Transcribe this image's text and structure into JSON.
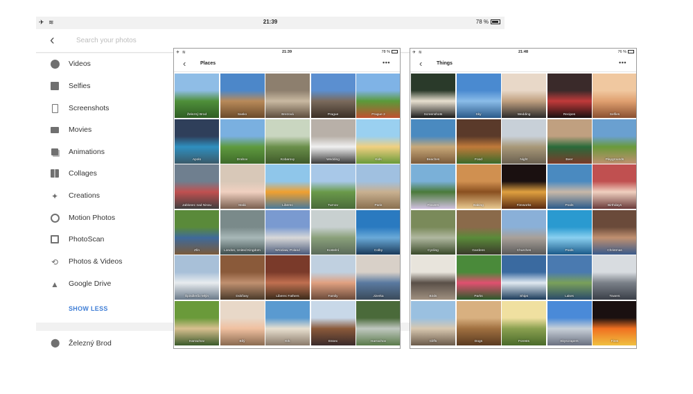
{
  "back_screen": {
    "status": {
      "time": "21:39",
      "battery": "78 %",
      "left_icons": "✈ ≋"
    },
    "search": {
      "placeholder": "Search your photos"
    },
    "categories": [
      {
        "label": "Videos",
        "icon": "play-circle-icon"
      },
      {
        "label": "Selfies",
        "icon": "person-square-icon"
      },
      {
        "label": "Screenshots",
        "icon": "phone-icon"
      },
      {
        "label": "Movies",
        "icon": "film-icon"
      },
      {
        "label": "Animations",
        "icon": "stack-icon"
      },
      {
        "label": "Collages",
        "icon": "grid-icon"
      },
      {
        "label": "Creations",
        "icon": "sparkle-icon"
      },
      {
        "label": "Motion Photos",
        "icon": "motion-icon"
      },
      {
        "label": "PhotoScan",
        "icon": "photoscan-icon"
      },
      {
        "label": "Photos & Videos",
        "icon": "sync-icon"
      },
      {
        "label": "Google Drive",
        "icon": "drive-icon"
      }
    ],
    "show_less": "SHOW LESS",
    "places_first": "Železný Brod"
  },
  "places_panel": {
    "status": {
      "time": "21:39",
      "battery": "78 %"
    },
    "title": "Places",
    "more": "•••",
    "tiles": [
      {
        "label": "Železný Brod",
        "colors": [
          "#8fbde6",
          "#4f8f3a",
          "#2f5e24"
        ]
      },
      {
        "label": "Sasko",
        "colors": [
          "#4c87c9",
          "#b88a5a",
          "#6b4a2a"
        ]
      },
      {
        "label": "Brezová",
        "colors": [
          "#8d7f6e",
          "#c9b9a1",
          "#5d4d3d"
        ]
      },
      {
        "label": "Prague",
        "colors": [
          "#5b8fd0",
          "#7a6a5c",
          "#3b2f25"
        ]
      },
      {
        "label": "Prague 2",
        "colors": [
          "#7fb3e6",
          "#5a9a3a",
          "#c05030"
        ]
      },
      {
        "label": "Apolo",
        "colors": [
          "#2f3f5a",
          "#2f8fbf",
          "#3a5a6a"
        ]
      },
      {
        "label": "Drahov",
        "colors": [
          "#7ab0e0",
          "#5e9a3e",
          "#3f6a2a"
        ]
      },
      {
        "label": "Kobarovy",
        "colors": [
          "#c9d6c0",
          "#6a8f4a",
          "#3f5a2a"
        ]
      },
      {
        "label": "Wedding",
        "colors": [
          "#b8b0a8",
          "#f0f0f0",
          "#3a3a3a"
        ]
      },
      {
        "label": "Kids",
        "colors": [
          "#9ad0f0",
          "#f0d080",
          "#6a9a3a"
        ]
      },
      {
        "label": "Jablonec nad Nisou",
        "colors": [
          "#6f7f8f",
          "#c05050",
          "#3f3f3f"
        ]
      },
      {
        "label": "Malá",
        "colors": [
          "#d8c8b8",
          "#f0d0c0",
          "#7a6050"
        ]
      },
      {
        "label": "Liberec",
        "colors": [
          "#8fc6ea",
          "#f0a030",
          "#4a7a9a"
        ]
      },
      {
        "label": "Turnov",
        "colors": [
          "#a8c8e8",
          "#6a9a4a",
          "#4a6a3a"
        ]
      },
      {
        "label": "Paris",
        "colors": [
          "#a0c0e0",
          "#c8b090",
          "#8a7050"
        ]
      },
      {
        "label": "Zlín",
        "colors": [
          "#5a8a3a",
          "#3f6a9a",
          "#7a5a3a"
        ]
      },
      {
        "label": "London, United Kingdom",
        "colors": [
          "#7a8a8a",
          "#a8b8b8",
          "#3f4f4f"
        ]
      },
      {
        "label": "Wrocław, Poland",
        "colors": [
          "#7a9ad0",
          "#d8d8d8",
          "#4a5a7a"
        ]
      },
      {
        "label": "Kostelní",
        "colors": [
          "#c8d0d0",
          "#8aa07a",
          "#5a6a5a"
        ]
      },
      {
        "label": "Colby",
        "colors": [
          "#2a7ac0",
          "#6aaad8",
          "#1a3a5a"
        ]
      },
      {
        "label": "Špindlerův Mlýn",
        "colors": [
          "#a8c0d8",
          "#e8ecef",
          "#6a7a8a"
        ]
      },
      {
        "label": "Dobřany",
        "colors": [
          "#8a5a3a",
          "#c09070",
          "#4a3a2a"
        ]
      },
      {
        "label": "Liberec Fathers",
        "colors": [
          "#7a3a2a",
          "#c07050",
          "#3a2a1a"
        ]
      },
      {
        "label": "Family",
        "colors": [
          "#c0d0e0",
          "#e0a080",
          "#6a4a3a"
        ]
      },
      {
        "label": "Jizerka",
        "colors": [
          "#d8d0c8",
          "#5a7aa0",
          "#3a4a5a"
        ]
      },
      {
        "label": "Harrachov",
        "colors": [
          "#6a9a3a",
          "#d8c090",
          "#3a5a2a"
        ]
      },
      {
        "label": "Bílý",
        "colors": [
          "#e8d8c8",
          "#f0c0a0",
          "#8a6a50"
        ]
      },
      {
        "label": "Krk",
        "colors": [
          "#5a9ad0",
          "#e8e0d0",
          "#8a7a6a"
        ]
      },
      {
        "label": "Essex",
        "colors": [
          "#c8d8e8",
          "#8a5a3a",
          "#3a2a2a"
        ]
      },
      {
        "label": "Harrachov",
        "colors": [
          "#4a6a3a",
          "#c0c8c0",
          "#5a7a4a"
        ]
      }
    ]
  },
  "things_panel": {
    "status": {
      "time": "21:48",
      "battery": "76 %"
    },
    "title": "Things",
    "more": "•••",
    "tiles": [
      {
        "label": "Screenshots",
        "colors": [
          "#2a3a2a",
          "#e8e0d0",
          "#1a1a1a"
        ]
      },
      {
        "label": "Sky",
        "colors": [
          "#4a8ad0",
          "#8abce8",
          "#2a5a8a"
        ]
      },
      {
        "label": "Wedding",
        "colors": [
          "#e8d8c8",
          "#c0a080",
          "#2a2a2a"
        ]
      },
      {
        "label": "Recipes",
        "colors": [
          "#3a2a2a",
          "#c03a3a",
          "#1a1010"
        ]
      },
      {
        "label": "Selfies",
        "colors": [
          "#f0c8a0",
          "#e0a070",
          "#8a5030"
        ]
      },
      {
        "label": "Beaches",
        "colors": [
          "#4a8ac0",
          "#c8a878",
          "#7a5a3a"
        ]
      },
      {
        "label": "Food",
        "colors": [
          "#5a3a2a",
          "#c07a3a",
          "#3a6a2a"
        ]
      },
      {
        "label": "Night",
        "colors": [
          "#c8d0d8",
          "#a89878",
          "#6a6050"
        ]
      },
      {
        "label": "Beer",
        "colors": [
          "#c0a080",
          "#2a6a3a",
          "#7a3a2a"
        ]
      },
      {
        "label": "Playgrounds",
        "colors": [
          "#6aa0d0",
          "#6a9a3a",
          "#c09070"
        ]
      },
      {
        "label": "Flowers",
        "colors": [
          "#7ab0d8",
          "#4a7a3a",
          "#d0c0e0"
        ]
      },
      {
        "label": "Baking",
        "colors": [
          "#d09050",
          "#8a5020",
          "#e8c890"
        ]
      },
      {
        "label": "Fireworks",
        "colors": [
          "#1a1010",
          "#e0a040",
          "#5a2a10"
        ]
      },
      {
        "label": "Pools",
        "colors": [
          "#4a8ac0",
          "#c8b8a8",
          "#2a5a8a"
        ]
      },
      {
        "label": "Birthdays",
        "colors": [
          "#c05050",
          "#f0d0c0",
          "#6a3a3a"
        ]
      },
      {
        "label": "Cycling",
        "colors": [
          "#7a8a5a",
          "#b0b8a0",
          "#3a4a2a"
        ]
      },
      {
        "label": "Gardens",
        "colors": [
          "#8a6a4a",
          "#5a8a3a",
          "#3a3a2a"
        ]
      },
      {
        "label": "Churches",
        "colors": [
          "#8ab0d8",
          "#a8a098",
          "#5a5a5a"
        ]
      },
      {
        "label": "Pools",
        "colors": [
          "#2a9ad0",
          "#8ad0f0",
          "#1a5a8a"
        ]
      },
      {
        "label": "Christmas",
        "colors": [
          "#6a4a3a",
          "#c09070",
          "#3a5a8a"
        ]
      },
      {
        "label": "Birds",
        "colors": [
          "#e8e4dc",
          "#5a5048",
          "#a09080"
        ]
      },
      {
        "label": "Parks",
        "colors": [
          "#4a8a3a",
          "#e05070",
          "#2a5a2a"
        ]
      },
      {
        "label": "Ships",
        "colors": [
          "#3a6aa0",
          "#e0e8f0",
          "#1a3a5a"
        ]
      },
      {
        "label": "Lakes",
        "colors": [
          "#4a7ab0",
          "#7aa05a",
          "#2a4a6a"
        ]
      },
      {
        "label": "Towers",
        "colors": [
          "#d8dce0",
          "#7a8088",
          "#3a3f48"
        ]
      },
      {
        "label": "Cliffs",
        "colors": [
          "#9ac0e0",
          "#d8c8b0",
          "#6a5a4a"
        ]
      },
      {
        "label": "Dogs",
        "colors": [
          "#d8b080",
          "#a07040",
          "#5a3a20"
        ]
      },
      {
        "label": "Forests",
        "colors": [
          "#f0e0a0",
          "#8aa050",
          "#4a6a2a"
        ]
      },
      {
        "label": "Skyscrapers",
        "colors": [
          "#4a8ad8",
          "#c8d0d8",
          "#6a7080"
        ]
      },
      {
        "label": "Fires",
        "colors": [
          "#1a1010",
          "#f07020",
          "#f0c040"
        ]
      }
    ]
  }
}
